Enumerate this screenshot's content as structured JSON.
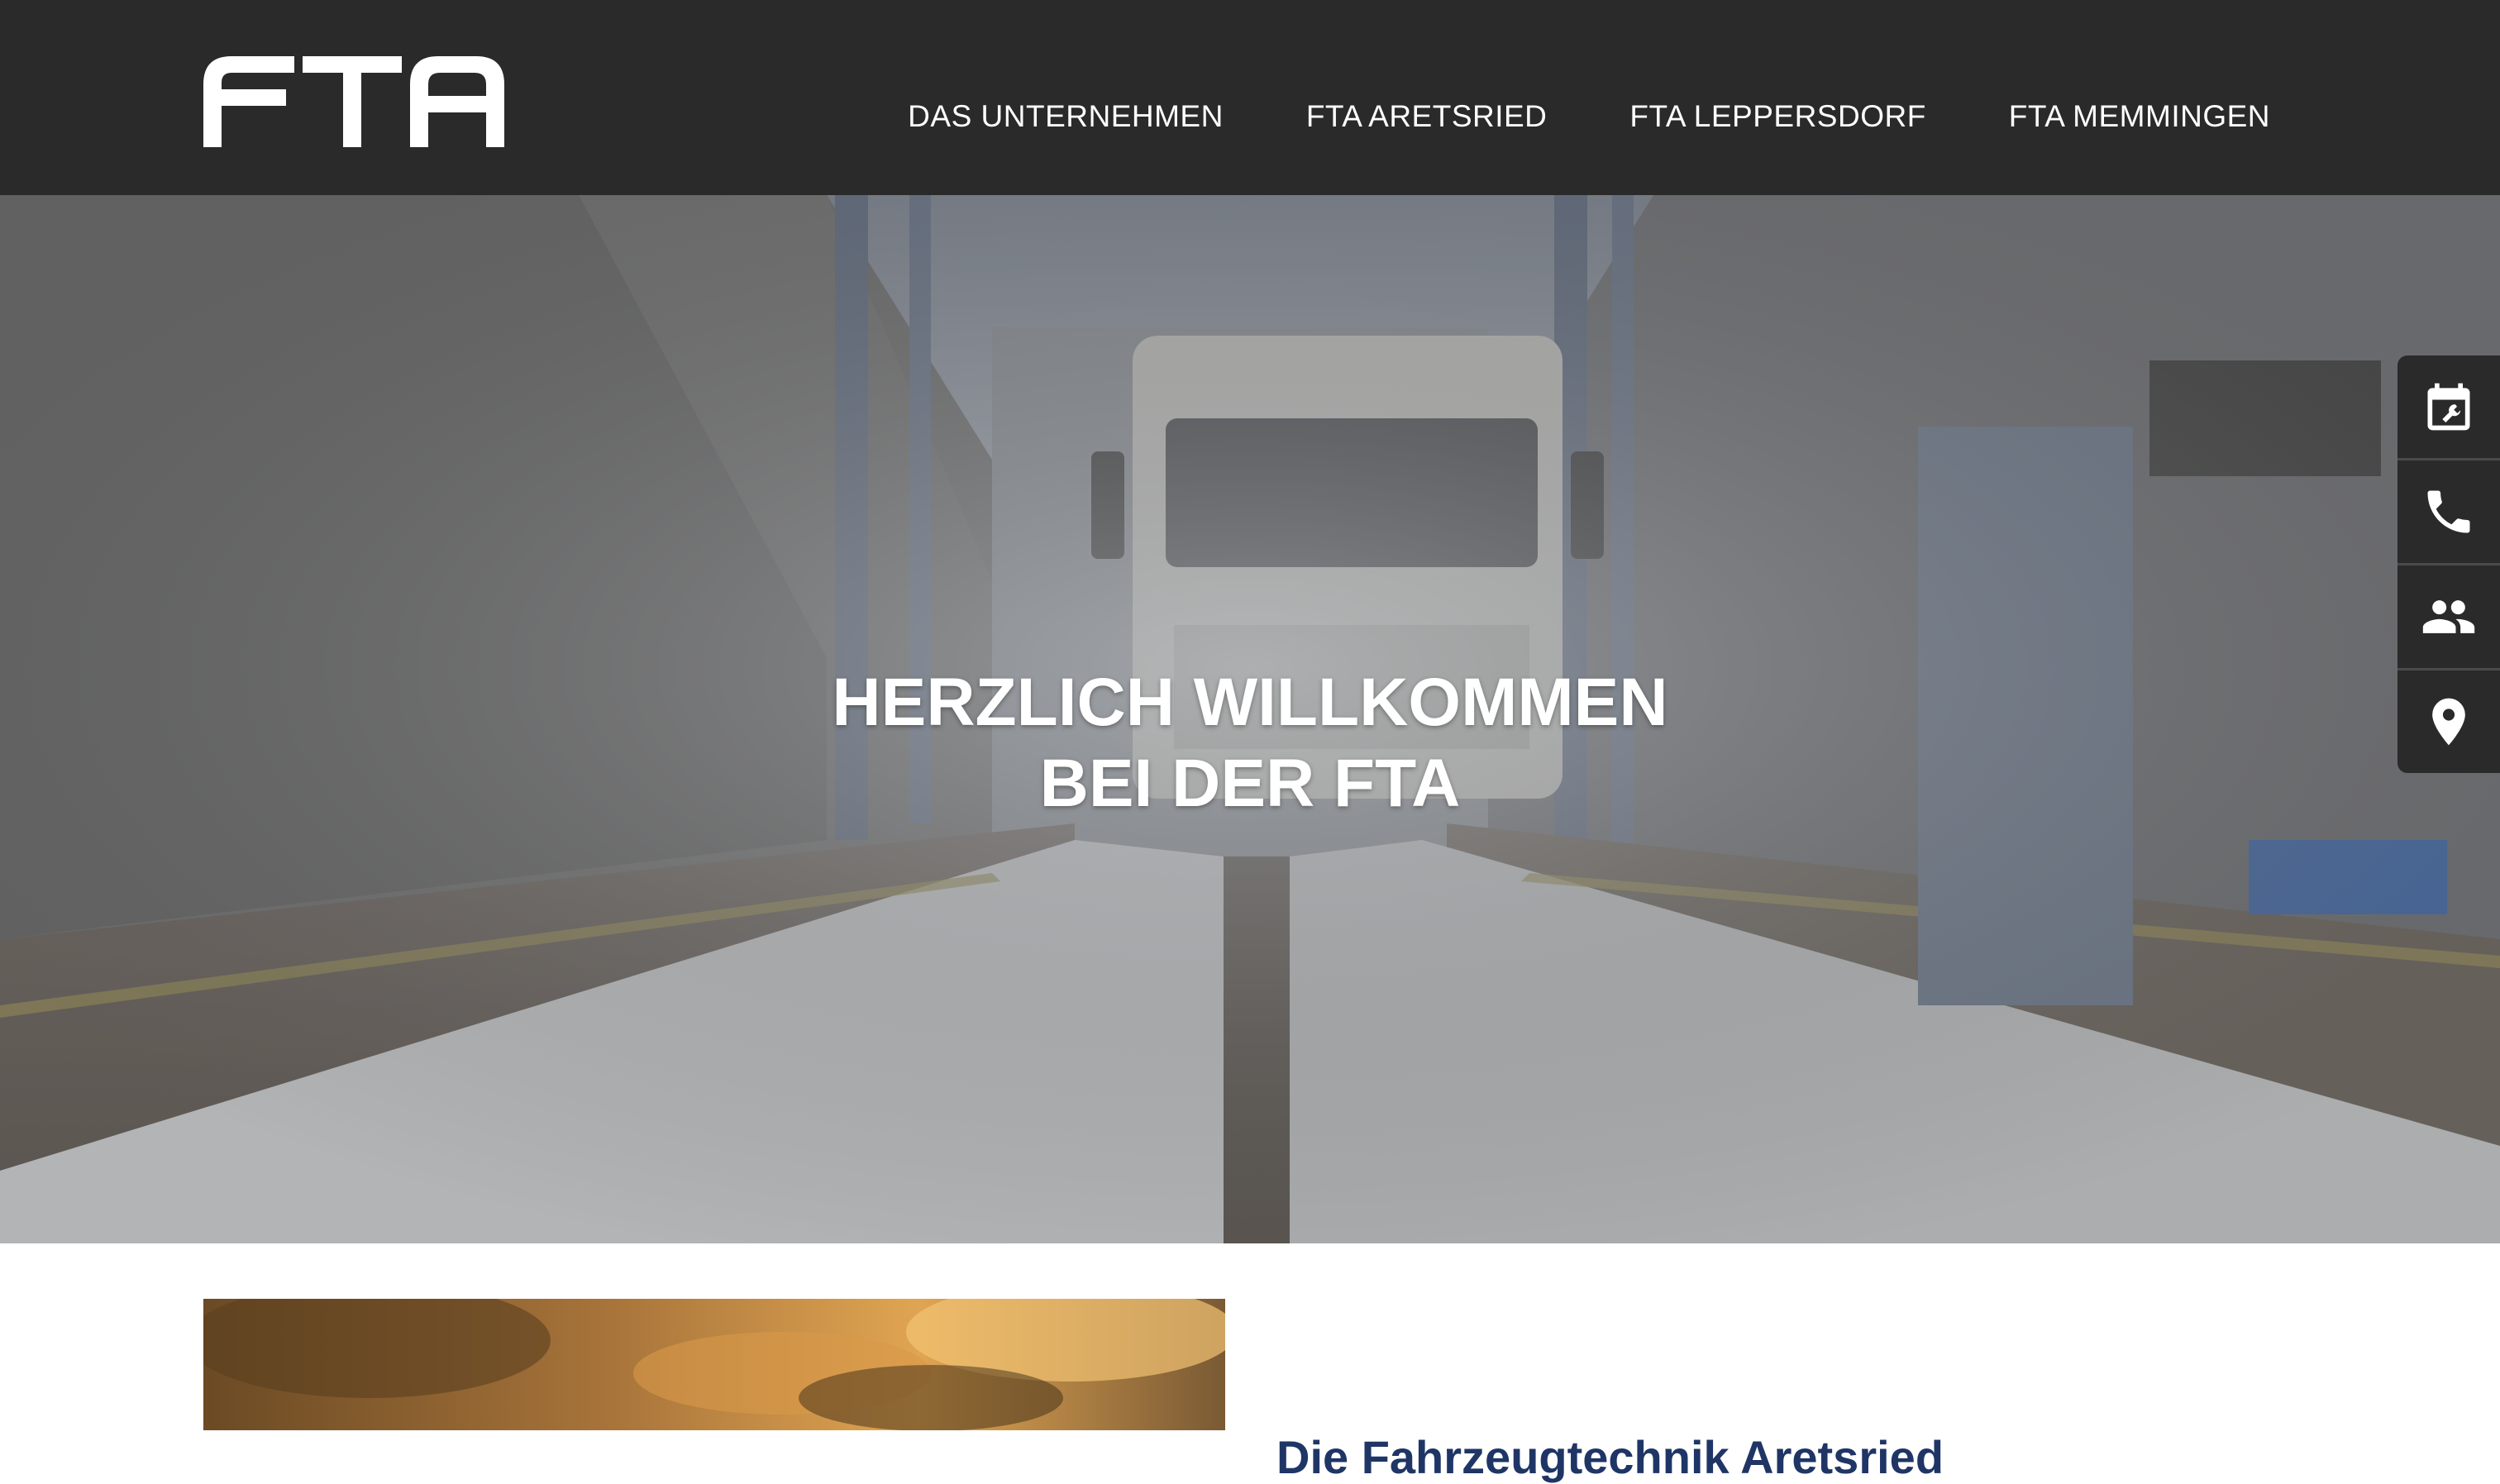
{
  "header": {
    "logo_text": "FTA",
    "nav": [
      {
        "label": "DAS UNTERNEHMEN"
      },
      {
        "label": "FTA ARETSRIED"
      },
      {
        "label": "FTA LEPPERSDORF"
      },
      {
        "label": "FTA MEMMINGEN"
      }
    ]
  },
  "hero": {
    "title_line1": "HERZLICH WILLKOMMEN",
    "title_line2": "BEI DER FTA"
  },
  "side_tools": [
    {
      "icon": "calendar-wrench-icon"
    },
    {
      "icon": "phone-icon"
    },
    {
      "icon": "people-icon"
    },
    {
      "icon": "location-pin-icon"
    }
  ],
  "content": {
    "heading": "Die Fahrzeugtechnik Aretsried"
  },
  "colors": {
    "header_bg": "#2a2a2a",
    "heading_color": "#1f3566",
    "text_light": "#ffffff"
  }
}
